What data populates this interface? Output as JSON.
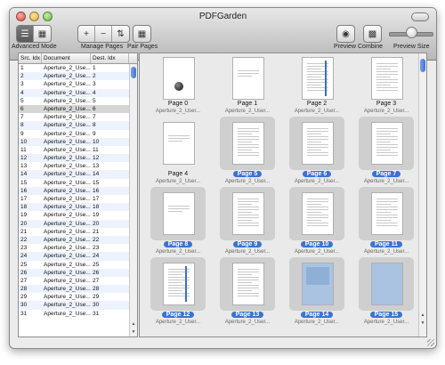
{
  "window": {
    "title": "PDFGarden"
  },
  "toolbar": {
    "advanced_mode_label": "Advanced Mode",
    "manage_pages_label": "Manage Pages",
    "pair_pages_label": "Pair Pages",
    "preview_label": "Preview",
    "combine_label": "Combine",
    "preview_size_label": "Preview Size",
    "preview_size_level": 0.55
  },
  "source_table": {
    "headers": [
      "Src. Idx",
      "Document",
      "Dest. Idx"
    ],
    "selected_row_index": 5,
    "rows": [
      [
        "1",
        "Aperture_2_Use...",
        "1"
      ],
      [
        "2",
        "Aperture_2_Use...",
        "2"
      ],
      [
        "3",
        "Aperture_2_Use...",
        "3"
      ],
      [
        "4",
        "Aperture_2_Use...",
        "4"
      ],
      [
        "5",
        "Aperture_2_Use...",
        "5"
      ],
      [
        "6",
        "Aperture_2_Use...",
        "6"
      ],
      [
        "7",
        "Aperture_2_Use...",
        "7"
      ],
      [
        "8",
        "Aperture_2_Use...",
        "8"
      ],
      [
        "9",
        "Aperture_2_Use...",
        "9"
      ],
      [
        "10",
        "Aperture_2_Use...",
        "10"
      ],
      [
        "11",
        "Aperture_2_Use...",
        "11"
      ],
      [
        "12",
        "Aperture_2_Use...",
        "12"
      ],
      [
        "13",
        "Aperture_2_Use...",
        "13"
      ],
      [
        "14",
        "Aperture_2_Use...",
        "14"
      ],
      [
        "15",
        "Aperture_2_Use...",
        "15"
      ],
      [
        "16",
        "Aperture_2_Use...",
        "16"
      ],
      [
        "17",
        "Aperture_2_Use...",
        "17"
      ],
      [
        "18",
        "Aperture_2_Use...",
        "18"
      ],
      [
        "19",
        "Aperture_2_Use...",
        "19"
      ],
      [
        "20",
        "Aperture_2_Use...",
        "20"
      ],
      [
        "21",
        "Aperture_2_Use...",
        "21"
      ],
      [
        "22",
        "Aperture_2_Use...",
        "22"
      ],
      [
        "23",
        "Aperture_2_Use...",
        "23"
      ],
      [
        "24",
        "Aperture_2_Use...",
        "24"
      ],
      [
        "25",
        "Aperture_2_Use...",
        "25"
      ],
      [
        "26",
        "Aperture_2_Use...",
        "26"
      ],
      [
        "27",
        "Aperture_2_Use...",
        "27"
      ],
      [
        "28",
        "Aperture_2_Use...",
        "28"
      ],
      [
        "29",
        "Aperture_2_Use...",
        "29"
      ],
      [
        "30",
        "Aperture_2_Use...",
        "30"
      ],
      [
        "31",
        "Aperture_2_Use...",
        "31"
      ]
    ]
  },
  "pages": [
    {
      "label": "Page 0",
      "source": "Aperture_2_User...",
      "selected": false
    },
    {
      "label": "Page 1",
      "source": "Aperture_2_User...",
      "selected": false
    },
    {
      "label": "Page 2",
      "source": "Aperture_2_User...",
      "selected": false
    },
    {
      "label": "Page 3",
      "source": "Aperture_2_User...",
      "selected": false
    },
    {
      "label": "Page 4",
      "source": "Aperture_2_User...",
      "selected": false
    },
    {
      "label": "Page 5",
      "source": "Aperture_2_User...",
      "selected": true
    },
    {
      "label": "Page 6",
      "source": "Aperture_2_User...",
      "selected": true
    },
    {
      "label": "Page 7",
      "source": "Aperture_2_User...",
      "selected": true
    },
    {
      "label": "Page 8",
      "source": "Aperture_2_User...",
      "selected": true
    },
    {
      "label": "Page 9",
      "source": "Aperture_2_User...",
      "selected": true
    },
    {
      "label": "Page 10",
      "source": "Aperture_2_User...",
      "selected": true
    },
    {
      "label": "Page 11",
      "source": "Aperture_2_User...",
      "selected": true
    },
    {
      "label": "Page 12",
      "source": "Aperture_2_User...",
      "selected": true
    },
    {
      "label": "Page 13",
      "source": "Aperture_2_User...",
      "selected": true
    },
    {
      "label": "Page 14",
      "source": "Aperture_2_User...",
      "selected": true
    },
    {
      "label": "Page 15",
      "source": "Aperture_2_User...",
      "selected": true
    }
  ],
  "icons": {
    "list_view": "list-icon",
    "grid_view": "grid-icon",
    "add": "plus-icon",
    "remove": "minus-icon",
    "sort": "sort-icon",
    "pair": "pair-icon",
    "preview": "eye-icon",
    "combine": "combine-icon"
  },
  "colors": {
    "selection": "#3a73d6",
    "page_stripe": "#3b6fc4"
  }
}
